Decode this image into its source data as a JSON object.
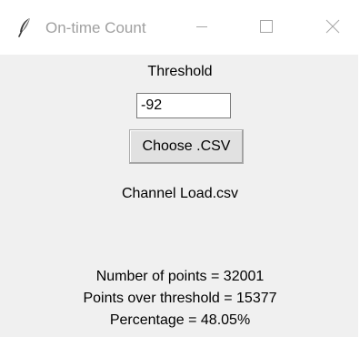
{
  "window": {
    "title": "On-time Count",
    "app_icon": "feather-icon",
    "controls": {
      "minimize_icon": "minimize-icon",
      "maximize_icon": "maximize-icon",
      "close_icon": "close-icon"
    }
  },
  "form": {
    "threshold_label": "Threshold",
    "threshold_value": "-92",
    "choose_button_label": "Choose .CSV",
    "selected_file": "Channel Load.csv"
  },
  "results": {
    "number_of_points": "Number of points = 32001",
    "points_over_threshold": "Points over threshold = 15377",
    "percentage": "Percentage = 48.05%"
  },
  "colors": {
    "client_background": "#f0f0f0",
    "titlebar_background": "#ffffff",
    "title_text": "#a0a0a0",
    "button_face": "#e1e1e1",
    "button_border": "#adadad"
  }
}
